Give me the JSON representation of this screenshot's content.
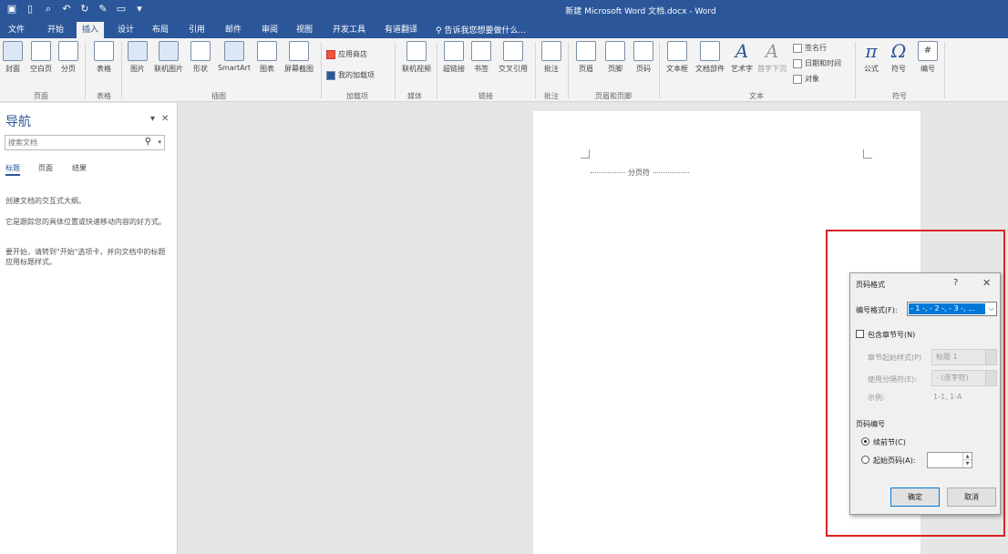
{
  "window": {
    "title": "新建 Microsoft Word 文档.docx - Word"
  },
  "qat": [
    "save-icon",
    "new-icon",
    "print-preview-icon",
    "undo-icon",
    "redo-icon",
    "edit-icon",
    "open-icon",
    "customize-icon"
  ],
  "tabs": [
    "文件",
    "开始",
    "插入",
    "设计",
    "布局",
    "引用",
    "邮件",
    "审阅",
    "视图",
    "开发工具",
    "有道翻译"
  ],
  "active_tab": "插入",
  "tell_me": "告诉我您想要做什么...",
  "ribbon": {
    "buttons": {
      "cover": "封面",
      "blank": "空白页",
      "break": "分页",
      "table": "表格",
      "picture": "图片",
      "online_picture": "联机图片",
      "shapes": "形状",
      "smartart": "SmartArt",
      "chart": "图表",
      "screenshot": "屏幕截图",
      "store": "应用商店",
      "my_addins": "我的加载项",
      "online_video": "联机视频",
      "hyperlink": "超链接",
      "bookmark": "书签",
      "cross_ref": "交叉引用",
      "comment": "批注",
      "header": "页眉",
      "footer": "页脚",
      "page_number": "页码",
      "textbox": "文本框",
      "quickparts": "文档部件",
      "wordart": "艺术字",
      "dropcap": "首字下沉",
      "signature": "签名行",
      "datetime": "日期和时间",
      "object": "对象",
      "equation": "公式",
      "symbol": "符号",
      "number": "编号"
    },
    "groups": {
      "pages": "页面",
      "tables": "表格",
      "illustrations": "插图",
      "addins": "加载项",
      "media": "媒体",
      "links": "链接",
      "comments": "批注",
      "header_footer": "页眉和页脚",
      "text": "文本",
      "symbols": "符号"
    },
    "glyphs": {
      "pi": "π",
      "omega": "Ω",
      "wordart_a": "A",
      "dropcap_a": "A",
      "number_hash": "#"
    }
  },
  "nav": {
    "title": "导航",
    "search_placeholder": "搜索文档",
    "tabs": [
      "标题",
      "页面",
      "结果"
    ],
    "text": [
      "创建文档的交互式大纲。",
      "它是跟踪您的具体位置或快速移动内容的好方式。",
      "要开始，请转到\"开始\"选项卡，并向文档中的标题应用标题样式。"
    ]
  },
  "document": {
    "page_break": "分页符"
  },
  "dialog": {
    "title": "页码格式",
    "help": "?",
    "close": "✕",
    "format_label": "编号格式(F):",
    "format_value": "- 1 -, - 2 -, - 3 -, ...",
    "include_chapter": "包含章节号(N)",
    "chapter_start_label": "章节起始样式(P)",
    "chapter_start_value": "标题 1",
    "separator_label": "使用分隔符(E):",
    "separator_value": "- (连字符)",
    "example_label": "示例:",
    "example_value": "1-1, 1-A",
    "numbering_label": "页码编号",
    "continue": "续前节(C)",
    "start_at": "起始页码(A):",
    "start_at_value": "",
    "ok": "确定",
    "cancel": "取消"
  },
  "colors": {
    "accent": "#2b579a",
    "highlight": "#dd2222",
    "selection": "#0078d7"
  }
}
